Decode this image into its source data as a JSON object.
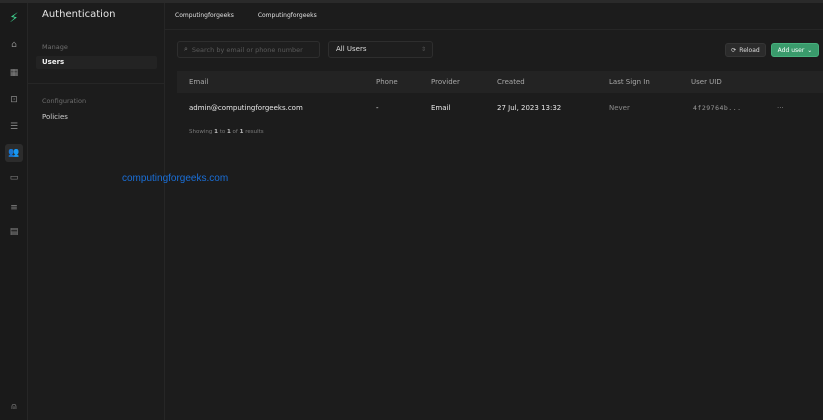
{
  "header": {
    "title": "Authentication",
    "breadcrumbs": [
      "Computingforgeeks",
      "Computingforgeeks"
    ]
  },
  "rail": {
    "icons": [
      "supabase-logo",
      "home-icon",
      "table-icon",
      "terminal-icon",
      "database-icon",
      "users-icon",
      "storage-icon",
      "list-icon",
      "document-icon",
      "user-icon"
    ]
  },
  "sidebar": {
    "sections": [
      {
        "label": "Manage",
        "items": [
          {
            "label": "Users",
            "active": true
          }
        ]
      },
      {
        "label": "Configuration",
        "items": [
          {
            "label": "Policies",
            "active": false
          }
        ]
      }
    ]
  },
  "toolbar": {
    "search_placeholder": "Search by email or phone number",
    "filter_value": "All Users",
    "reload_label": "Reload",
    "add_user_label": "Add user"
  },
  "table": {
    "columns": [
      "Email",
      "Phone",
      "Provider",
      "Created",
      "Last Sign In",
      "User UID"
    ],
    "rows": [
      {
        "email": "admin@computingforgeeks.com",
        "phone": "-",
        "provider": "Email",
        "created": "27 Jul, 2023 13:32",
        "last_sign_in": "Never",
        "uid": "4f29764b...",
        "more": "···"
      }
    ],
    "footer": {
      "prefix": "Showing",
      "from": "1",
      "to_word": "to",
      "to": "1",
      "of_word": "of",
      "total": "1",
      "suffix": "results"
    }
  },
  "watermark": "computingforgeeks.com",
  "colors": {
    "accent": "#3ecf8e",
    "button_green": "#3a9b6c",
    "watermark": "#1a6fd8"
  }
}
